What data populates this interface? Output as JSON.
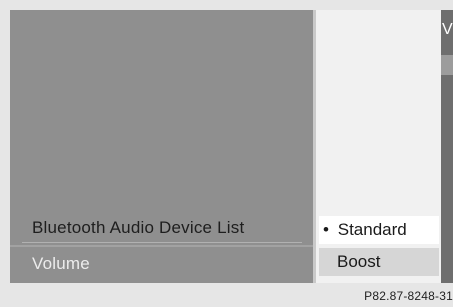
{
  "menu": {
    "items": [
      {
        "label": "Bluetooth Audio Device List"
      },
      {
        "label": "Volume"
      }
    ]
  },
  "popup": {
    "options": [
      {
        "label": "Standard",
        "bullet": "•",
        "selected": true
      },
      {
        "label": "Boost",
        "selected": false
      }
    ]
  },
  "edge": {
    "fragment": "V"
  },
  "reference": "P82.87-8248-31"
}
